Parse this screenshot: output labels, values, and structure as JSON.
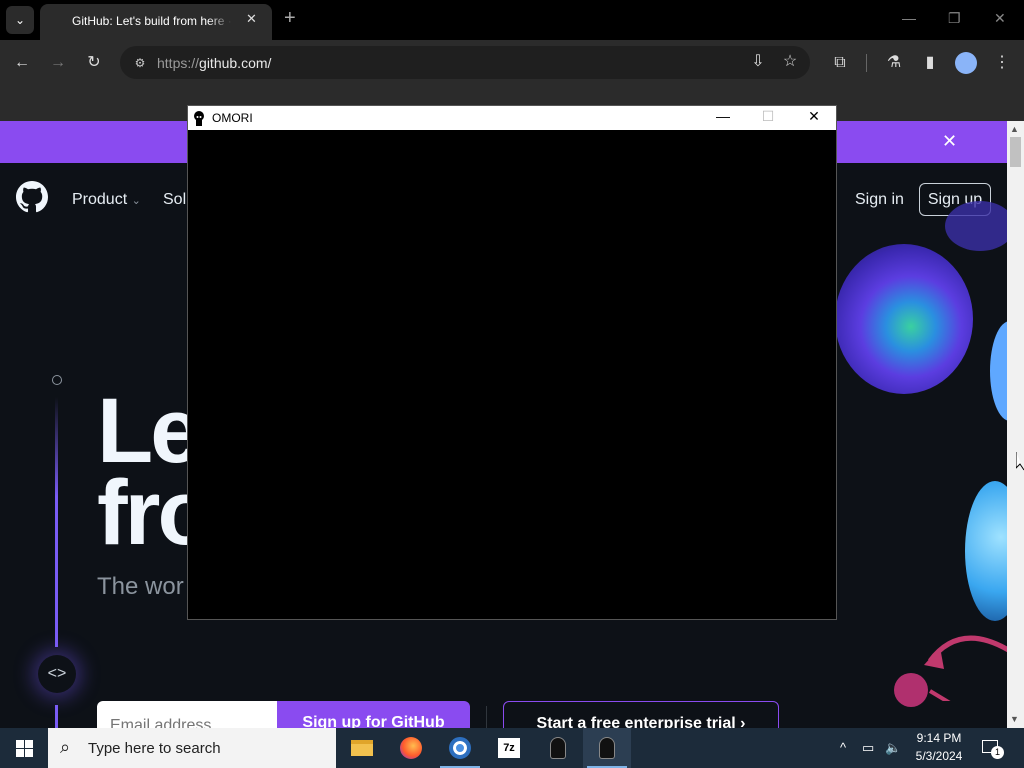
{
  "browser": {
    "tab_title": "GitHub: Let's build from here · GitHub",
    "tab_close": "✕",
    "new_tab": "+",
    "url_scheme": "https://",
    "url_host": "github.com/",
    "window_controls": {
      "minimize": "—",
      "restore": "❐",
      "close": "✕"
    }
  },
  "page": {
    "banner_close": "✕",
    "nav": {
      "product": "Product",
      "solutions": "Solu"
    },
    "sign_in": "Sign in",
    "sign_up": "Sign up",
    "hero_line1": "Le",
    "hero_line2": "fro",
    "hero_sub": "The wor",
    "email_placeholder": "Email address",
    "signup_github": "Sign up for GitHub",
    "enterprise_trial": "Start a free enterprise trial  ›",
    "code_icon": "<>"
  },
  "omori_window": {
    "title": "OMORI",
    "minimize": "—",
    "maximize": "☐",
    "close": "✕"
  },
  "taskbar": {
    "search_placeholder": "Type here to search",
    "time": "9:14 PM",
    "date": "5/3/2024",
    "notification_count": "1",
    "apps": [
      "file-explorer",
      "firefox",
      "chrome",
      "7zip",
      "omori",
      "omori"
    ]
  },
  "colors": {
    "banner": "#8a4bf0",
    "page_bg": "#0d1117",
    "taskbar": "#1c2b3a"
  }
}
